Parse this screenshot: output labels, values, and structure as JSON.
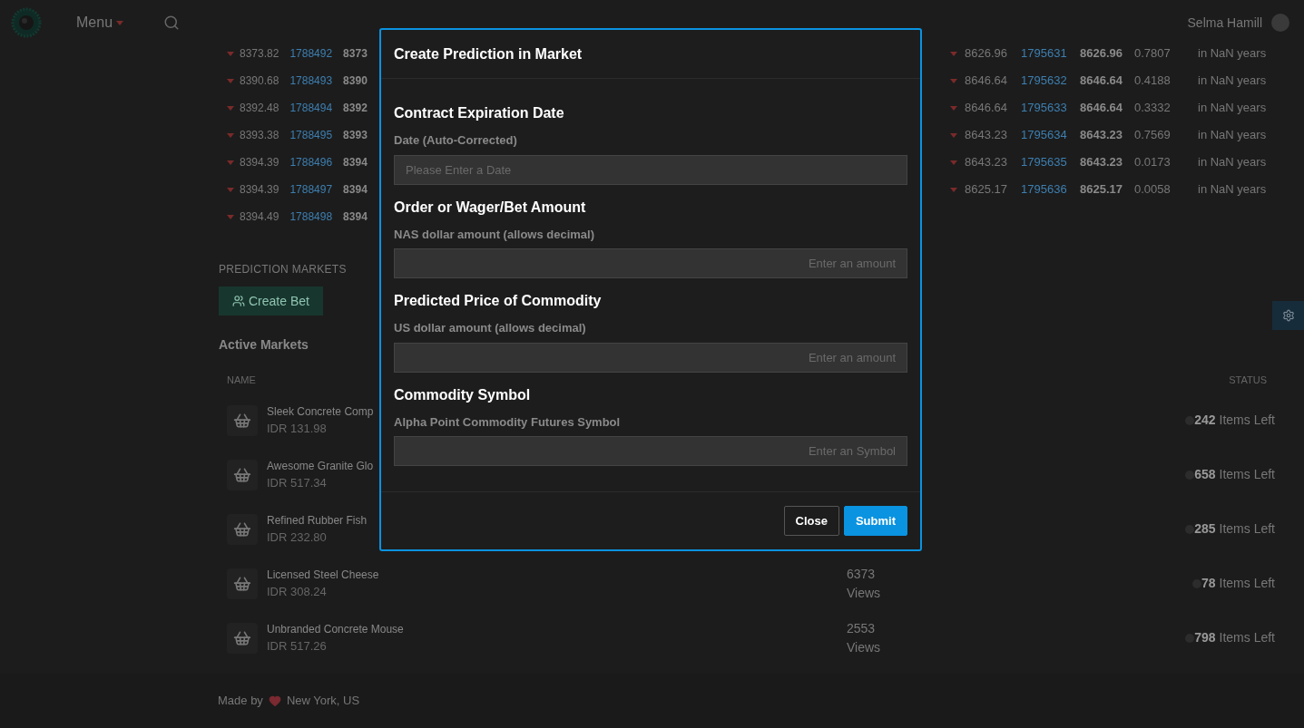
{
  "header": {
    "menu_label": "Menu",
    "user_name": "Selma Hamill"
  },
  "trades_left": [
    {
      "price": "8373.82",
      "id": "1788492",
      "price2": "8373"
    },
    {
      "price": "8390.68",
      "id": "1788493",
      "price2": "8390"
    },
    {
      "price": "8392.48",
      "id": "1788494",
      "price2": "8392"
    },
    {
      "price": "8393.38",
      "id": "1788495",
      "price2": "8393"
    },
    {
      "price": "8394.39",
      "id": "1788496",
      "price2": "8394"
    },
    {
      "price": "8394.39",
      "id": "1788497",
      "price2": "8394"
    },
    {
      "price": "8394.49",
      "id": "1788498",
      "price2": "8394"
    }
  ],
  "trades_right": [
    {
      "price": "8626.96",
      "id": "1795631",
      "price2": "8626.96",
      "size": "0.7807",
      "time": "in NaN years"
    },
    {
      "price": "8646.64",
      "id": "1795632",
      "price2": "8646.64",
      "size": "0.4188",
      "time": "in NaN years"
    },
    {
      "price": "8646.64",
      "id": "1795633",
      "price2": "8646.64",
      "size": "0.3332",
      "time": "in NaN years"
    },
    {
      "price": "8643.23",
      "id": "1795634",
      "price2": "8643.23",
      "size": "0.7569",
      "time": "in NaN years"
    },
    {
      "price": "8643.23",
      "id": "1795635",
      "price2": "8643.23",
      "size": "0.0173",
      "time": "in NaN years"
    },
    {
      "price": "8625.17",
      "id": "1795636",
      "price2": "8625.17",
      "size": "0.0058",
      "time": "in NaN years"
    }
  ],
  "markets": {
    "section_title": "PREDICTION MARKETS",
    "create_button": "Create Bet",
    "subtitle": "Active Markets",
    "columns": [
      "NAME",
      "STATUS"
    ],
    "rows": [
      {
        "name": "Sleek Concrete Comp",
        "price": "IDR 131.98",
        "count": "242",
        "status": "Items Left"
      },
      {
        "name": "Awesome Granite Glo",
        "price": "IDR 517.34",
        "count": "658",
        "status": "Items Left"
      },
      {
        "name": "Refined Rubber Fish",
        "price": "IDR 232.80",
        "count": "285",
        "status": "Items Left"
      },
      {
        "name": "Licensed Steel Cheese",
        "price": "IDR 308.24",
        "views": "6373",
        "views_label": "Views",
        "count": "78",
        "status": "Items Left"
      },
      {
        "name": "Unbranded Concrete Mouse",
        "price": "IDR 517.26",
        "views": "2553",
        "views_label": "Views",
        "count": "798",
        "status": "Items Left"
      }
    ]
  },
  "footer": {
    "made_by": "Made by",
    "location": "New York, US"
  },
  "modal": {
    "title": "Create Prediction in Market",
    "sections": [
      {
        "heading": "Contract Expiration Date",
        "label": "Date (Auto-Corrected)",
        "placeholder": "Please Enter a Date",
        "kind": "date"
      },
      {
        "heading": "Order or Wager/Bet Amount",
        "label": "NAS dollar amount (allows decimal)",
        "placeholder": "Enter an amount",
        "kind": "number"
      },
      {
        "heading": "Predicted Price of Commodity",
        "label": "US dollar amount (allows decimal)",
        "placeholder": "Enter an amount",
        "kind": "number"
      },
      {
        "heading": "Commodity Symbol",
        "label": "Alpha Point Commodity Futures Symbol",
        "placeholder": "Enter an Symbol",
        "kind": "number"
      }
    ],
    "buttons": [
      {
        "label": "Close",
        "kind": "secondary"
      },
      {
        "label": "Submit",
        "kind": "primary"
      }
    ]
  }
}
